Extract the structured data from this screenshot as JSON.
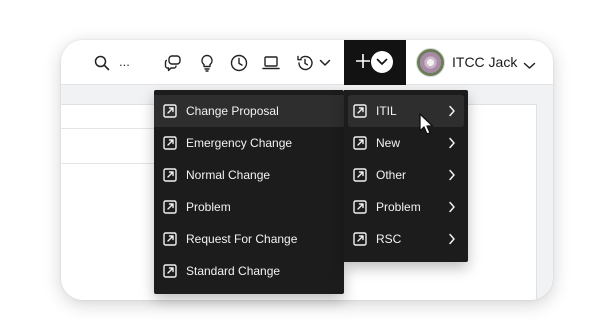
{
  "search": {
    "placeholder_ellipsis": "..."
  },
  "topbar_icons": [
    "search-icon",
    "chat-icon",
    "lightbulb-icon",
    "clock-icon",
    "laptop-icon",
    "history-icon",
    "chevron-down-icon"
  ],
  "create_button": {
    "icon": "plus-icon"
  },
  "user": {
    "name": "ITCC Jack"
  },
  "menu_left": {
    "items": [
      {
        "label": "Change Proposal",
        "active": true
      },
      {
        "label": "Emergency Change"
      },
      {
        "label": "Normal Change"
      },
      {
        "label": "Problem"
      },
      {
        "label": "Request For Change"
      },
      {
        "label": "Standard Change"
      }
    ]
  },
  "menu_right": {
    "items": [
      {
        "label": "ITIL",
        "active": true
      },
      {
        "label": "New"
      },
      {
        "label": "Other"
      },
      {
        "label": "Problem"
      },
      {
        "label": "RSC"
      }
    ]
  },
  "colors": {
    "menu_bg": "#1c1c1c",
    "menu_active": "#2e2e2e",
    "menu_text": "#f2f2f2",
    "create_button_bg": "#121212"
  }
}
